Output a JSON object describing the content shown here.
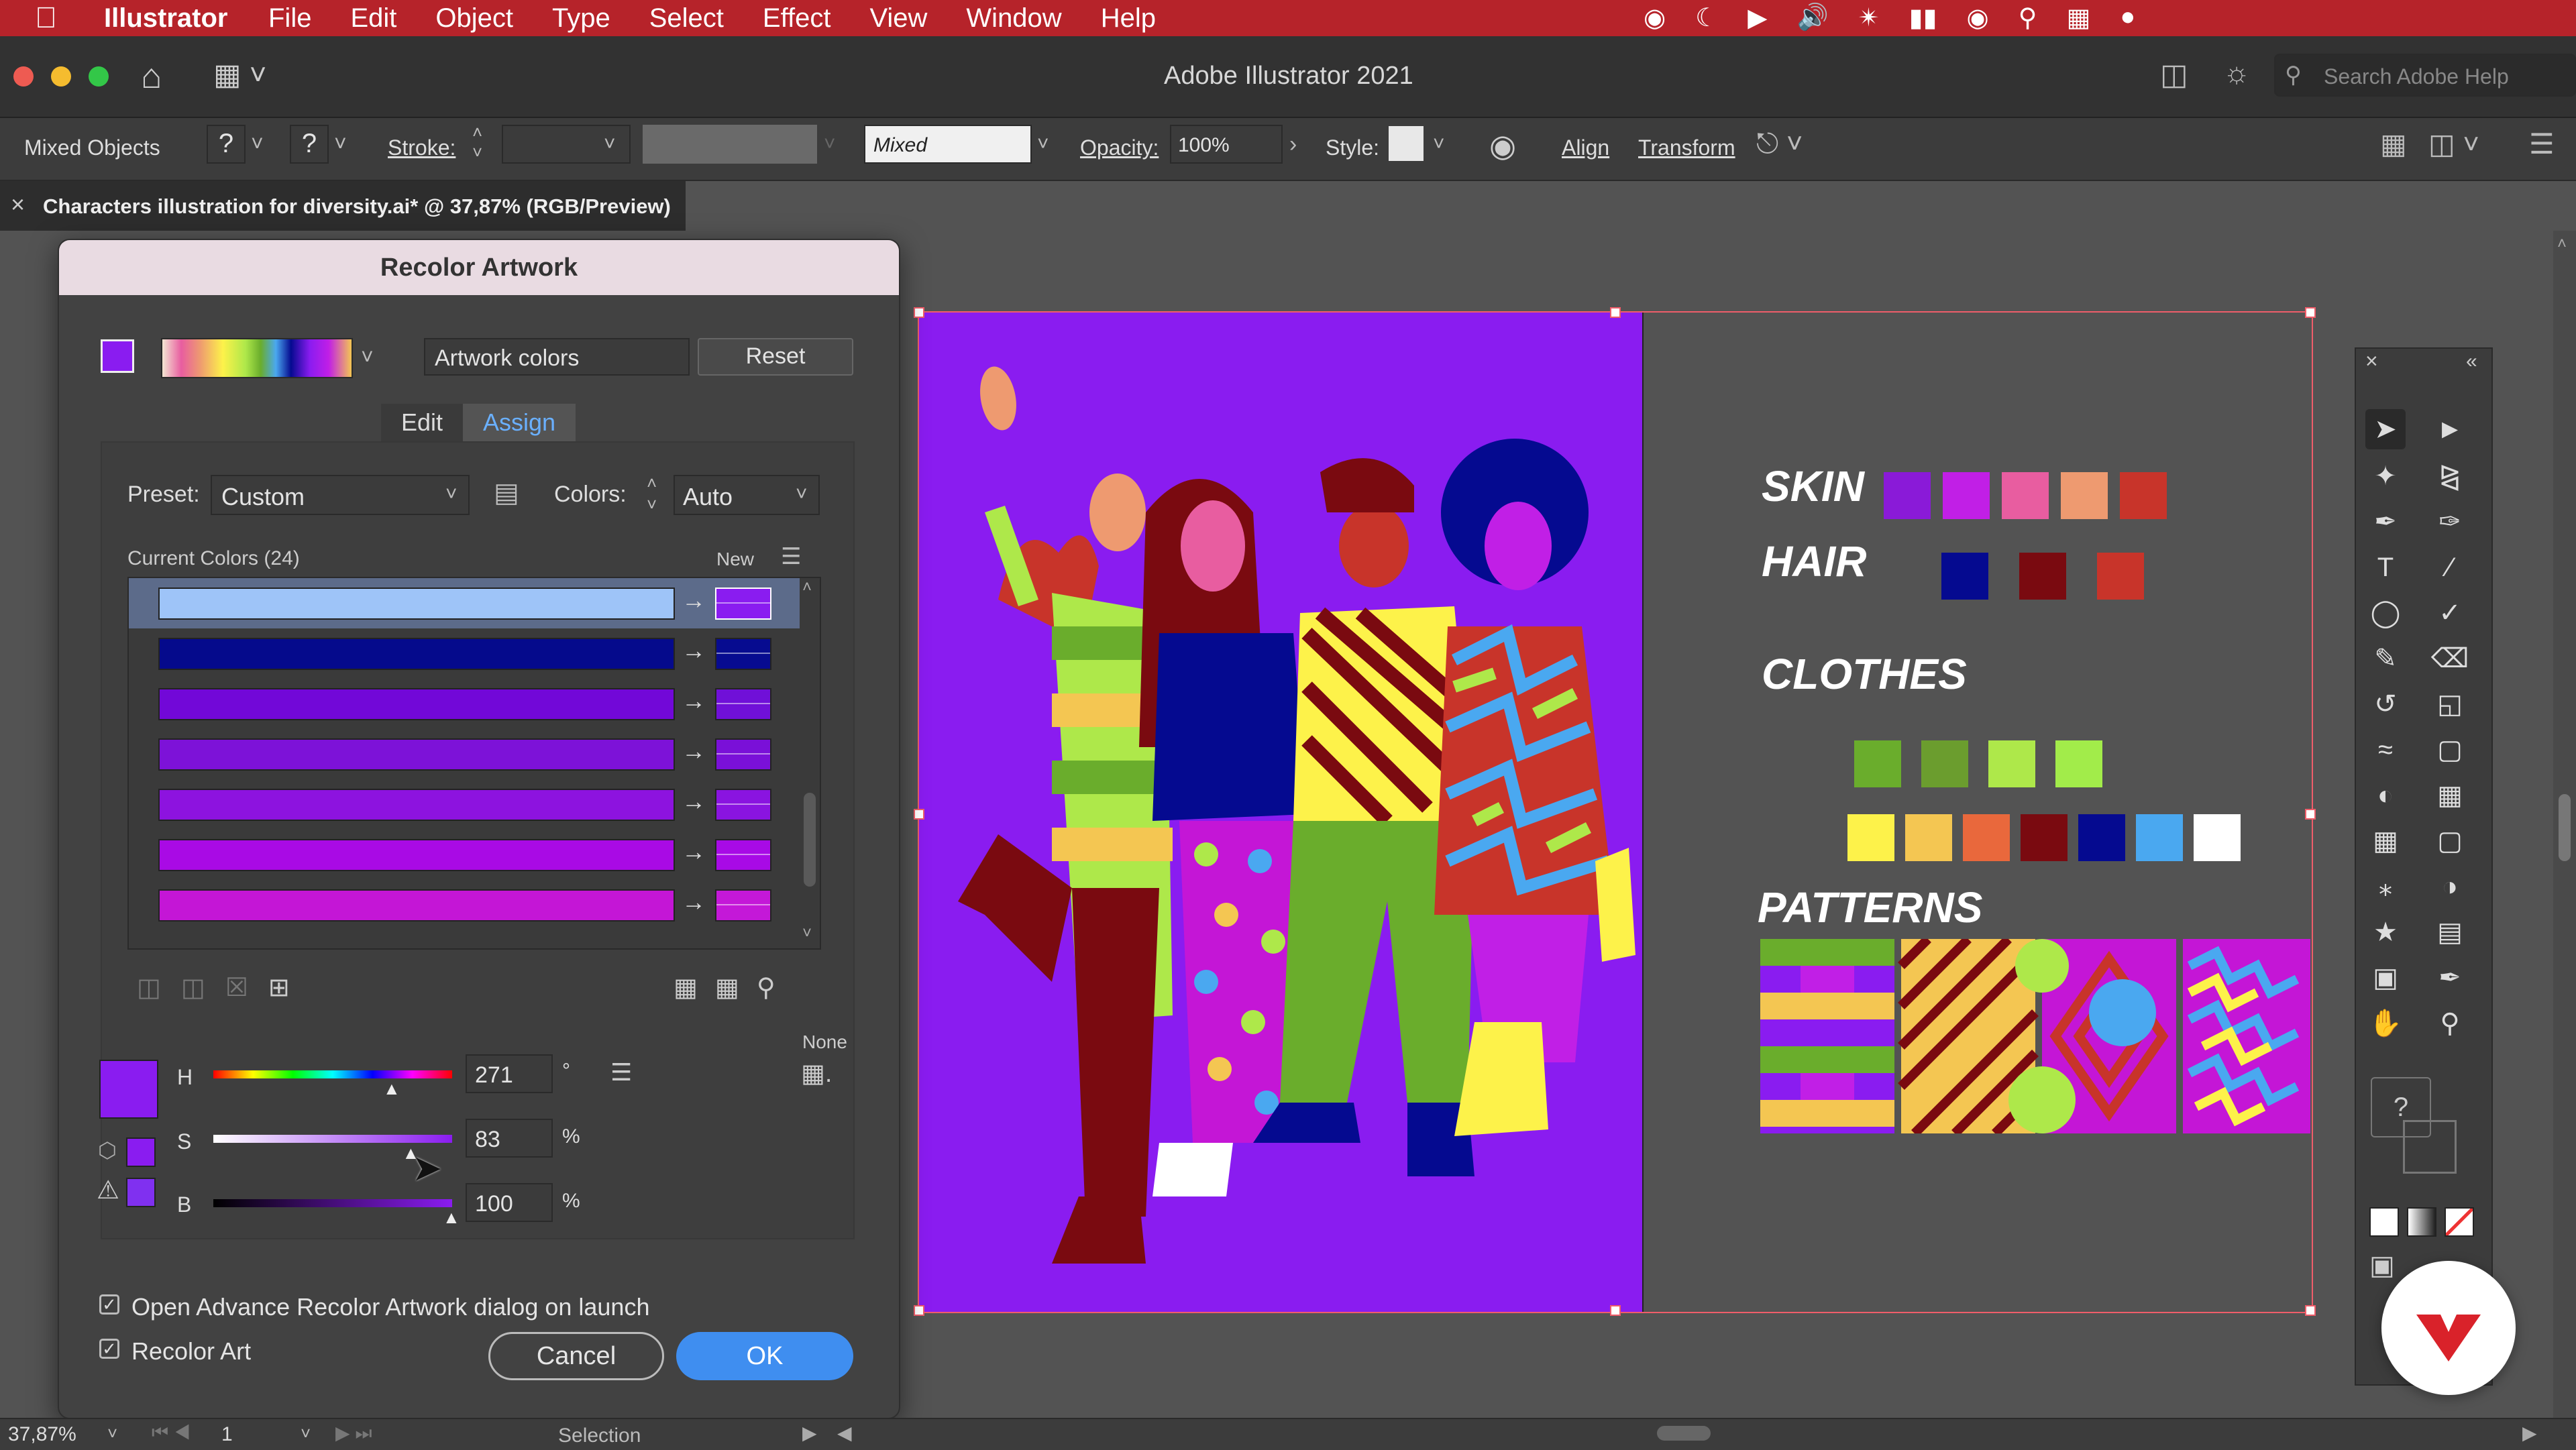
{
  "menubar": {
    "app_name": "Illustrator",
    "items": [
      "File",
      "Edit",
      "Object",
      "Type",
      "Select",
      "Effect",
      "View",
      "Window",
      "Help"
    ]
  },
  "titlebar": {
    "title": "Adobe Illustrator 2021",
    "search_placeholder": "Search Adobe Help"
  },
  "control_bar": {
    "selection_label": "Mixed Objects",
    "stroke_label": "Stroke:",
    "brush_value": "Mixed",
    "opacity_label": "Opacity:",
    "opacity_value": "100%",
    "style_label": "Style:",
    "align_label": "Align",
    "transform_label": "Transform"
  },
  "document_tab": {
    "title": "Characters illustration for diversity.ai* @ 37,87% (RGB/Preview)"
  },
  "recolor": {
    "title": "Recolor Artwork",
    "artwork_colors_value": "Artwork colors",
    "reset_label": "Reset",
    "tabs": {
      "edit": "Edit",
      "assign": "Assign"
    },
    "preset_label": "Preset:",
    "preset_value": "Custom",
    "colors_label": "Colors:",
    "colors_value": "Auto",
    "current_colors_label": "Current Colors (24)",
    "new_label": "New",
    "rows": [
      {
        "current": "#9ec4f8",
        "new": "#8a1cf0"
      },
      {
        "current": "#050a8c",
        "new": "#070b90"
      },
      {
        "current": "#7208d8",
        "new": "#7010d8"
      },
      {
        "current": "#7d12d8",
        "new": "#7a10d8"
      },
      {
        "current": "#8d13df",
        "new": "#8a14e0"
      },
      {
        "current": "#a90ae5",
        "new": "#a80ae6"
      },
      {
        "current": "#c416d6",
        "new": "#c418d8"
      }
    ],
    "none_label": "None",
    "h_label": "H",
    "h_value": "271",
    "h_unit": "°",
    "h_fraction": 0.75,
    "s_label": "S",
    "s_value": "83",
    "s_unit": "%",
    "s_fraction": 0.83,
    "b_label": "B",
    "b_value": "100",
    "b_unit": "%",
    "b_fraction": 1.0,
    "selected_color": "#8a1cf0",
    "open_advance_label": "Open Advance Recolor Artwork dialog on launch",
    "recolor_art_label": "Recolor Art",
    "cancel_label": "Cancel",
    "ok_label": "OK"
  },
  "artboard": {
    "background": "#8a1cf0",
    "swatches": {
      "skin_title": "SKIN",
      "skin": [
        "#8a1ad8",
        "#c11fe6",
        "#e85da0",
        "#ee9a70",
        "#c8342a"
      ],
      "hair_title": "HAIR",
      "hair": [
        "#050a90",
        "#7a0a10",
        "#c8342a"
      ],
      "clothes_title": "CLOTHES",
      "clothes_row1": [
        "#6aad2c",
        "#6b9d2e",
        "#aee84a",
        "#a2ec4a"
      ],
      "clothes_row2": [
        "#fdf24a",
        "#f4c652",
        "#e9683c",
        "#7a0a10",
        "#050a90",
        "#4aa8f0",
        "#ffffff"
      ],
      "patterns_title": "PATTERNS"
    }
  },
  "status_bar": {
    "zoom": "37,87%",
    "page": "1",
    "tool": "Selection"
  }
}
